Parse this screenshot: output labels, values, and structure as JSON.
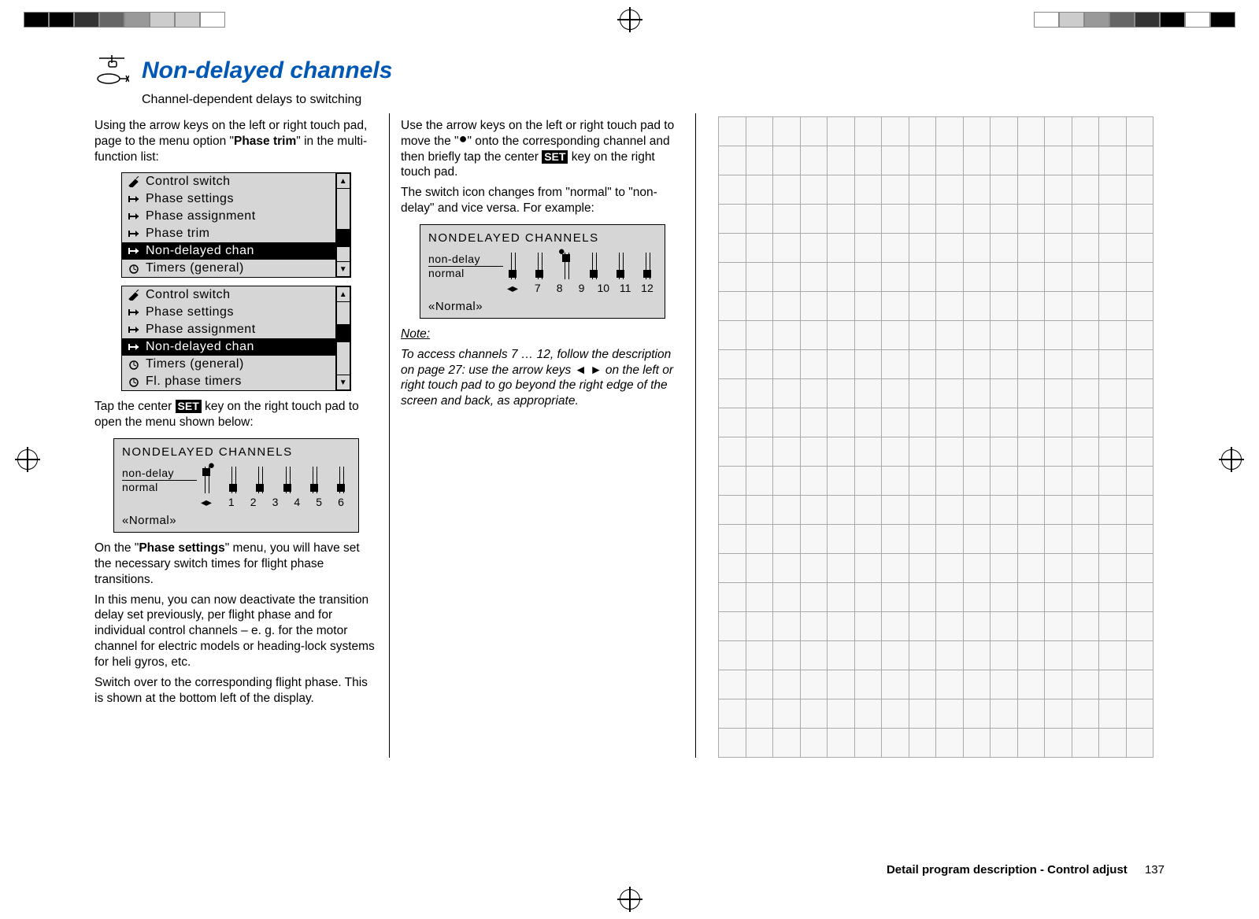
{
  "header": {
    "title": "Non-delayed channels",
    "subtitle": "Channel-dependent delays to switching"
  },
  "col1": {
    "p1a": "Using the arrow keys on the left or right touch pad, page to the menu option \"",
    "p1bold": "Phase trim",
    "p1b": "\" in the multi-function list:",
    "menu1": [
      {
        "icon": "tool",
        "label": "Control switch",
        "sel": false
      },
      {
        "icon": "phase",
        "label": "Phase settings",
        "sel": false
      },
      {
        "icon": "phase",
        "label": "Phase assignment",
        "sel": false
      },
      {
        "icon": "phase",
        "label": "Phase trim",
        "sel": false
      },
      {
        "icon": "phase",
        "label": "Non-delayed chan",
        "sel": true
      },
      {
        "icon": "clock",
        "label": "Timers (general)",
        "sel": false
      }
    ],
    "menu2": [
      {
        "icon": "tool",
        "label": "Control switch",
        "sel": false
      },
      {
        "icon": "phase",
        "label": "Phase settings",
        "sel": false
      },
      {
        "icon": "phase",
        "label": "Phase assignment",
        "sel": false
      },
      {
        "icon": "phase",
        "label": "Non-delayed chan",
        "sel": true
      },
      {
        "icon": "clock",
        "label": "Timers (general)",
        "sel": false
      },
      {
        "icon": "clock",
        "label": "Fl. phase timers",
        "sel": false
      }
    ],
    "p2a": "Tap the center ",
    "p2set": "SET",
    "p2b": " key on the right touch pad to open the menu shown below:",
    "panel1": {
      "title": "NONDELAYED  CHANNELS",
      "row1": "non-delay",
      "row2": "normal",
      "nums": [
        "1",
        "2",
        "3",
        "4",
        "5",
        "6"
      ],
      "states": [
        "up",
        "dn",
        "dn",
        "dn",
        "dn",
        "dn"
      ],
      "foot": "Normal"
    },
    "p3a": "On the \"",
    "p3bold": "Phase settings",
    "p3b": "\" menu, you will have set the necessary switch times for flight phase transitions.",
    "p4": "In this menu, you can now deactivate the transition delay set previously, per flight phase and for individual control channels – e. g. for the motor channel for electric models or heading-lock systems for heli gyros, etc.",
    "p5": "Switch over to the corresponding flight phase. This is shown at the bottom left of the display."
  },
  "col2": {
    "p1a": "Use the arrow keys on the left or right touch pad to move the \"",
    "p1b": "\" onto the corresponding channel and then briefly tap the center ",
    "p1set": "SET",
    "p1c": " key on the right touch pad.",
    "p2": "The switch icon changes from \"normal\" to \"non-delay\" and vice versa. For example:",
    "panel2": {
      "title": "NONDELAYED  CHANNELS",
      "row1": "non-delay",
      "row2": "normal",
      "nums": [
        "7",
        "8",
        "9",
        "10",
        "11",
        "12"
      ],
      "states": [
        "dn",
        "dn",
        "up",
        "dn",
        "dn",
        "dn"
      ],
      "foot": "Normal"
    },
    "note_t": "Note:",
    "note_b": "To access channels 7 … 12, follow the description on page 27: use the arrow keys ◄ ► on the left or right touch pad to go beyond the right edge of the screen and back, as appropriate."
  },
  "footer": {
    "section": "Detail program description - Control adjust",
    "page": "137"
  }
}
